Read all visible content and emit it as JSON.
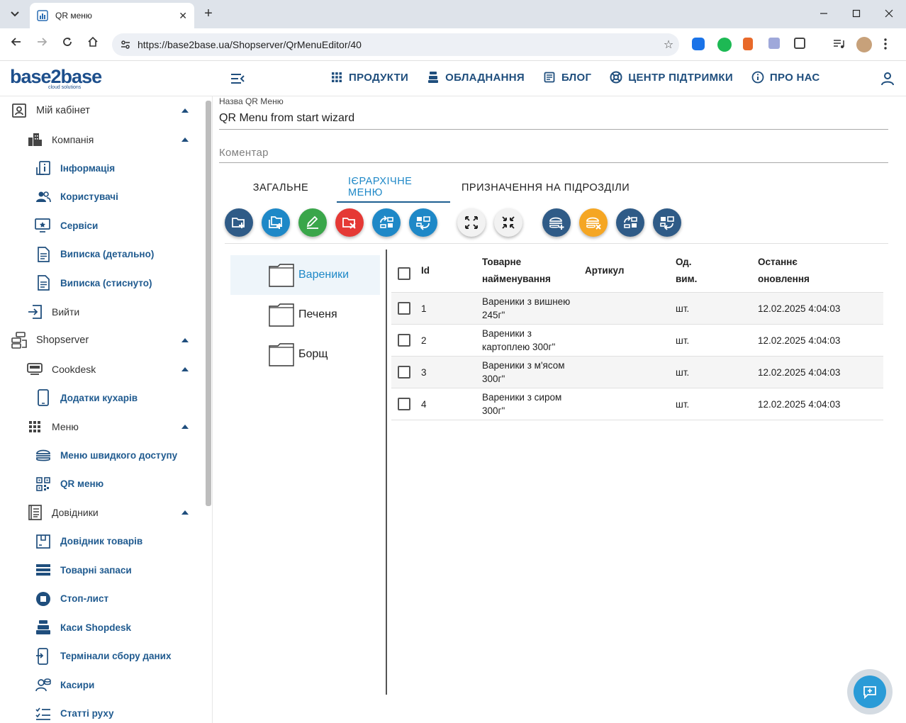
{
  "browser": {
    "tab_title": "QR меню",
    "url": "https://base2base.ua/Shopserver/QrMenuEditor/40",
    "new_tab": "+",
    "close_tab": "✕"
  },
  "header": {
    "logo": "base2base",
    "logo_sub": "cloud solutions",
    "nav": [
      {
        "label": "ПРОДУКТИ",
        "icon": "grid-icon"
      },
      {
        "label": "ОБЛАДНАННЯ",
        "icon": "cash-register-icon"
      },
      {
        "label": "БЛОГ",
        "icon": "document-icon"
      },
      {
        "label": "ЦЕНТР ПІДТРИМКИ",
        "icon": "lifebuoy-icon"
      },
      {
        "label": "ПРО НАС",
        "icon": "info-icon"
      }
    ]
  },
  "sidebar": {
    "items": [
      {
        "label": "Мій кабінет",
        "level": 0,
        "icon": "account-box-icon",
        "expanded": true
      },
      {
        "label": "Компанія",
        "level": 1,
        "icon": "building-icon",
        "expanded": true
      },
      {
        "label": "Інформація",
        "level": 2,
        "icon": "info-doc-icon"
      },
      {
        "label": "Користувачі",
        "level": 2,
        "icon": "users-icon"
      },
      {
        "label": "Сервіси",
        "level": 2,
        "icon": "monitor-star-icon"
      },
      {
        "label": "Виписка (детально)",
        "level": 2,
        "icon": "statement-icon"
      },
      {
        "label": "Виписка (стиснуто)",
        "level": 2,
        "icon": "statement-icon"
      },
      {
        "label": "Вийти",
        "level": 1,
        "icon": "logout-icon"
      },
      {
        "label": "Shopserver",
        "level": 0,
        "icon": "server-icon",
        "expanded": true
      },
      {
        "label": "Cookdesk",
        "level": 1,
        "icon": "cookdesk-icon",
        "expanded": true
      },
      {
        "label": "Додатки кухарів",
        "level": 2,
        "icon": "tablet-icon"
      },
      {
        "label": "Меню",
        "level": 1,
        "icon": "grid-icon",
        "expanded": true
      },
      {
        "label": "Меню швидкого доступу",
        "level": 2,
        "icon": "burger-icon"
      },
      {
        "label": "QR меню",
        "level": 2,
        "icon": "qr-icon"
      },
      {
        "label": "Довідники",
        "level": 1,
        "icon": "book-icon",
        "expanded": true
      },
      {
        "label": "Довідник товарів",
        "level": 2,
        "icon": "box-icon"
      },
      {
        "label": "Товарні запаси",
        "level": 2,
        "icon": "stock-icon"
      },
      {
        "label": "Стоп-лист",
        "level": 2,
        "icon": "stop-icon"
      },
      {
        "label": "Каси Shopdesk",
        "level": 2,
        "icon": "cash-register-icon"
      },
      {
        "label": "Термінали сбору даних",
        "level": 2,
        "icon": "terminal-icon"
      },
      {
        "label": "Касири",
        "level": 2,
        "icon": "cashier-icon"
      },
      {
        "label": "Статті руху",
        "level": 2,
        "icon": "checklist-icon"
      }
    ]
  },
  "form": {
    "name_label": "Назва QR Меню",
    "name_value": "QR Menu from start wizard",
    "comment_placeholder": "Коментар"
  },
  "tabs": [
    {
      "label": "ЗАГАЛЬНЕ",
      "active": false
    },
    {
      "label": "ІЄРАРХІЧНЕ МЕНЮ",
      "active": true
    },
    {
      "label": "ПРИЗНАЧЕННЯ НА ПІДРОЗДІЛИ",
      "active": false
    }
  ],
  "toolbar": [
    {
      "name": "add-folder-button",
      "color": "#2f5b87",
      "icon": "folder-plus-icon"
    },
    {
      "name": "add-subfolder-button",
      "color": "#1e88c7",
      "icon": "folder-copy-plus-icon"
    },
    {
      "name": "edit-button",
      "color": "#3aa64a",
      "icon": "pencil-icon"
    },
    {
      "name": "delete-folder-button",
      "color": "#e53935",
      "icon": "folder-remove-icon"
    },
    {
      "name": "move-up-button",
      "color": "#1e88c7",
      "icon": "swap-icon"
    },
    {
      "name": "move-down-button",
      "color": "#1e88c7",
      "icon": "swap-alt-icon"
    },
    {
      "name": "expand-button",
      "color": "#f2f2f2",
      "icon": "expand-icon"
    },
    {
      "name": "collapse-button",
      "color": "#f2f2f2",
      "icon": "collapse-icon"
    },
    {
      "name": "add-product-button",
      "color": "#2f5b87",
      "icon": "burger-plus-icon"
    },
    {
      "name": "remove-product-button",
      "color": "#f5a623",
      "icon": "burger-remove-icon"
    },
    {
      "name": "product-move-up-button",
      "color": "#2f5b87",
      "icon": "swap-icon"
    },
    {
      "name": "product-move-down-button",
      "color": "#2f5b87",
      "icon": "swap-alt-icon"
    }
  ],
  "tree": [
    {
      "label": "Вареники",
      "selected": true
    },
    {
      "label": "Печеня",
      "selected": false
    },
    {
      "label": "Борщ",
      "selected": false
    }
  ],
  "table": {
    "headers": {
      "id": "Id",
      "name_1": "Товарне",
      "name_2": "найменування",
      "article": "Артикул",
      "unit_1": "Од.",
      "unit_2": "вим.",
      "updated_1": "Останнє",
      "updated_2": "оновлення"
    },
    "rows": [
      {
        "id": "1",
        "name_1": "Вареники з вишнею",
        "name_2": "245г\"",
        "article": "",
        "unit": "шт.",
        "updated": "12.02.2025 4:04:03"
      },
      {
        "id": "2",
        "name_1": "Вареники з",
        "name_2": "картоплею 300г\"",
        "article": "",
        "unit": "шт.",
        "updated": "12.02.2025 4:04:03"
      },
      {
        "id": "3",
        "name_1": "Вареники з м'ясом",
        "name_2": "300г\"",
        "article": "",
        "unit": "шт.",
        "updated": "12.02.2025 4:04:03"
      },
      {
        "id": "4",
        "name_1": "Вареники з сиром",
        "name_2": "300г\"",
        "article": "",
        "unit": "шт.",
        "updated": "12.02.2025 4:04:03"
      }
    ]
  }
}
